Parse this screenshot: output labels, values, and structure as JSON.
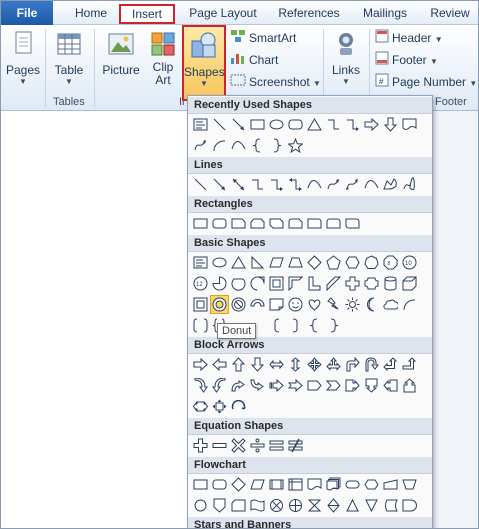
{
  "tabs": [
    "File",
    "Home",
    "Insert",
    "Page Layout",
    "References",
    "Mailings",
    "Review"
  ],
  "ribbon": {
    "pages_label": "Pages",
    "table_label": "Table",
    "tables_group": "Tables",
    "picture_label": "Picture",
    "clipart_label": "Clip\nArt",
    "illustrations_group_partial": "Il",
    "shapes_label": "Shapes",
    "smartart_label": "SmartArt",
    "chart_label": "Chart",
    "screenshot_label": "Screenshot",
    "links_label": "Links",
    "header_label": "Header",
    "footer_label": "Footer",
    "page_number_label": "Page Number",
    "footer_group": "Footer"
  },
  "dropdown": {
    "sections": [
      {
        "title": "Recently Used Shapes",
        "rows": [
          [
            "textbox",
            "line",
            "arrow-line",
            "rectangle",
            "oval",
            "rounded-rect",
            "triangle",
            "elbow",
            "elbow-arrow",
            "right-arrow",
            "down-arrow",
            "flowchart-doc"
          ],
          [
            "curve-arrow",
            "arc",
            "curve",
            "left-brace",
            "right-brace",
            "star"
          ]
        ]
      },
      {
        "title": "Lines",
        "rows": [
          [
            "line",
            "arrow-line",
            "double-arrow",
            "elbow",
            "elbow-arrow",
            "elbow-double",
            "curve",
            "curve-arrow",
            "curve-double",
            "curve",
            "freeform",
            "scribble"
          ]
        ]
      },
      {
        "title": "Rectangles",
        "rows": [
          [
            "rectangle",
            "rounded-rect",
            "snip1",
            "snip2",
            "snip-diag",
            "snip-round",
            "round1",
            "round2",
            "round-diag"
          ]
        ]
      },
      {
        "title": "Basic Shapes",
        "rows": [
          [
            "textbox",
            "oval",
            "triangle",
            "right-triangle",
            "parallelogram",
            "trapezoid",
            "diamond",
            "pentagon",
            "hexagon",
            "heptagon",
            "octagon",
            "decagon"
          ],
          [
            "dodecagon",
            "pie",
            "chord",
            "teardrop",
            "frame",
            "half-frame",
            "l-shape",
            "diag-stripe",
            "cross",
            "plaque",
            "can",
            "cube"
          ],
          [
            "bevel",
            "donut",
            "no-symbol",
            "block-arc",
            "folded-corner",
            "smiley",
            "heart",
            "lightning",
            "sun",
            "moon",
            "cloud",
            "arc"
          ],
          [
            "bracket-pair",
            "brace-pair",
            "blank",
            "blank",
            "left-bracket",
            "right-bracket",
            "left-brace",
            "right-brace"
          ]
        ]
      },
      {
        "title": "Block Arrows",
        "rows": [
          [
            "right-arrow",
            "left-arrow",
            "up-arrow",
            "down-arrow",
            "left-right-arrow",
            "up-down-arrow",
            "quad-arrow",
            "left-right-up",
            "bent-arrow",
            "u-turn",
            "left-up",
            "bent-up"
          ],
          [
            "curved-right",
            "curved-left",
            "curved-up",
            "curved-down",
            "striped-right",
            "notched-right",
            "pentagon-arrow",
            "chevron",
            "right-callout",
            "down-callout",
            "left-callout",
            "up-callout"
          ],
          [
            "left-right-callout",
            "quad-callout",
            "circular-arrow"
          ]
        ]
      },
      {
        "title": "Equation Shapes",
        "rows": [
          [
            "plus",
            "minus",
            "multiply",
            "divide",
            "equal",
            "not-equal"
          ]
        ]
      },
      {
        "title": "Flowchart",
        "rows": [
          [
            "rectangle",
            "rounded-rect",
            "diamond",
            "parallelogram",
            "predefined",
            "internal",
            "flowchart-doc",
            "multidoc",
            "terminator",
            "preparation",
            "manual-input",
            "manual-op"
          ],
          [
            "connector",
            "offpage",
            "card",
            "punched-tape",
            "summing",
            "or",
            "collate",
            "sort",
            "extract",
            "merge",
            "stored-data",
            "delay"
          ]
        ]
      },
      {
        "title": "Stars and Banners",
        "rows": []
      }
    ]
  },
  "tooltip": "Donut",
  "colors": {
    "tab_active_border": "#d0222a",
    "file_tab": "#2a68b8",
    "shapes_highlight": "#f6c65b",
    "section_head_bg": "#dde4ee",
    "shape_stroke": "#2a3f5f"
  }
}
